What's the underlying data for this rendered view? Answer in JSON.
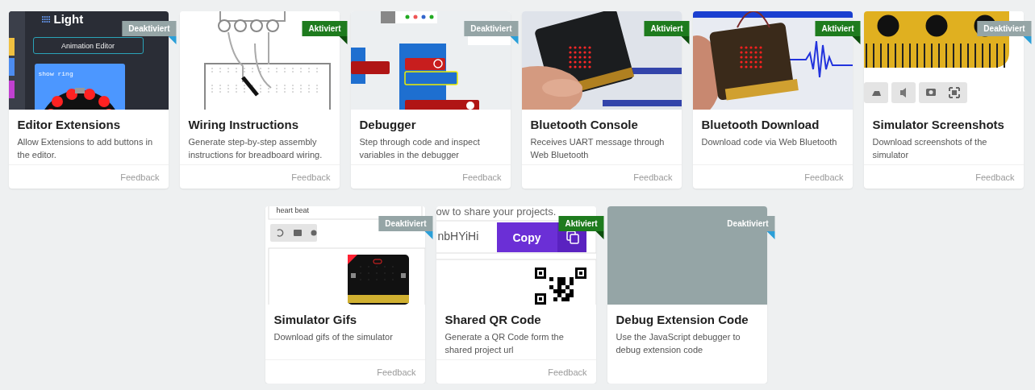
{
  "cards": [
    {
      "title": "Editor Extensions",
      "description": "Allow Extensions to add buttons in the editor.",
      "status": {
        "label": "Deaktiviert",
        "enabled": false
      },
      "feedback": "Feedback",
      "preview": {
        "kind": "blocks-editor",
        "texts": [
          "Light",
          "Animation Editor",
          "show ring"
        ]
      }
    },
    {
      "title": "Wiring Instructions",
      "description": "Generate step-by-step assembly instructions for breadboard wiring.",
      "status": {
        "label": "Aktiviert",
        "enabled": true
      },
      "feedback": "Feedback",
      "preview": {
        "kind": "breadboard"
      }
    },
    {
      "title": "Debugger",
      "description": "Step through code and inspect variables in the debugger",
      "status": {
        "label": "Deaktiviert",
        "enabled": false
      },
      "feedback": "Feedback",
      "preview": {
        "kind": "code-blocks"
      }
    },
    {
      "title": "Bluetooth Console",
      "description": "Receives UART message through Web Bluetooth",
      "status": {
        "label": "Aktiviert",
        "enabled": true
      },
      "feedback": "Feedback"
    },
    {
      "title": "Bluetooth Download",
      "description": "Download code via Web Bluetooth",
      "status": {
        "label": "Aktiviert",
        "enabled": true
      },
      "feedback": "Feedback"
    },
    {
      "title": "Simulator Screenshots",
      "description": "Download screenshots of the simulator",
      "status": {
        "label": "Deaktiviert",
        "enabled": false
      },
      "feedback": "Feedback",
      "preview": {
        "kind": "simulator"
      }
    },
    {
      "title": "Simulator Gifs",
      "description": "Download gifs of the simulator",
      "status": {
        "label": "Deaktiviert",
        "enabled": false
      },
      "feedback": "Feedback",
      "preview": {
        "kind": "gif-recorder",
        "texts": [
          "heart beat"
        ]
      }
    },
    {
      "title": "Shared QR Code",
      "description": "Generate a QR Code form the shared project url",
      "status": {
        "label": "Aktiviert",
        "enabled": true
      },
      "feedback": "Feedback",
      "preview": {
        "kind": "share",
        "texts": [
          "ow to share your projects.",
          "nbHYiHi",
          "Copy"
        ]
      }
    },
    {
      "title": "Debug Extension Code",
      "description": "Use the JavaScript debugger to debug extension code",
      "status": {
        "label": "Deaktiviert",
        "enabled": false
      },
      "preview": {
        "kind": "blank"
      }
    }
  ]
}
